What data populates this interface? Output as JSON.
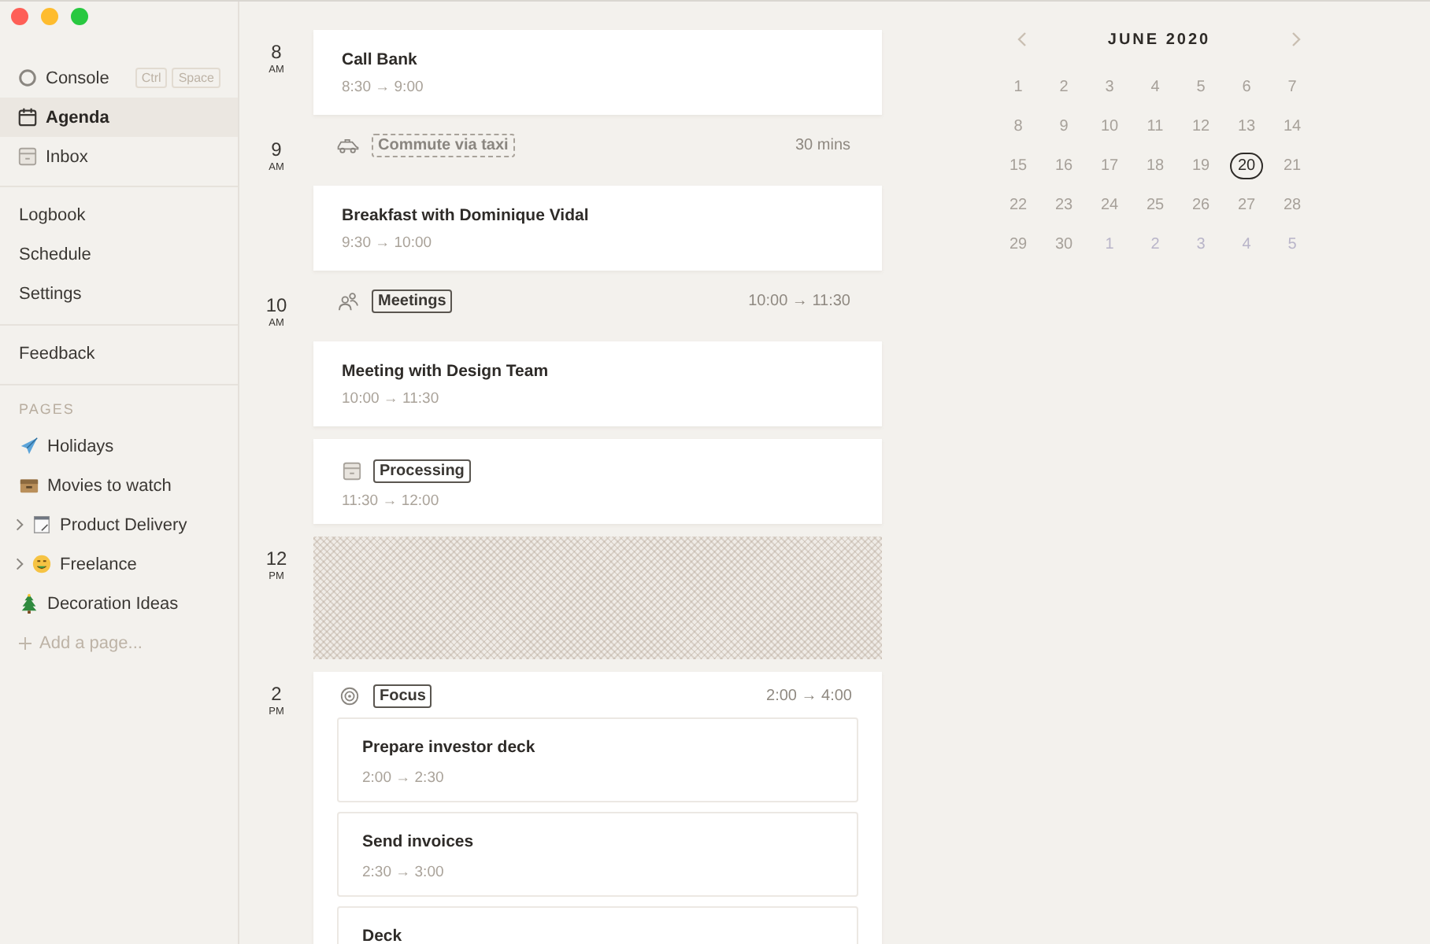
{
  "window_controls": [
    {
      "kind": "close"
    },
    {
      "kind": "minimize"
    },
    {
      "kind": "zoom"
    }
  ],
  "sidebar": {
    "nav": [
      {
        "label": "Console",
        "kind": "circle",
        "selected": false,
        "shortcut": [
          "Ctrl",
          "Space"
        ]
      },
      {
        "label": "Agenda",
        "kind": "calendar",
        "selected": true
      },
      {
        "label": "Inbox",
        "kind": "inbox",
        "selected": false
      }
    ],
    "sections": [
      [
        "Logbook",
        "Schedule",
        "Settings"
      ],
      [
        "Feedback"
      ]
    ],
    "pages_heading": "PAGES",
    "pages": [
      {
        "label": "Holidays",
        "kind": "plane"
      },
      {
        "label": "Movies to watch",
        "kind": "box"
      },
      {
        "label": "Product Delivery",
        "kind": "note",
        "expanded": false
      },
      {
        "label": "Freelance",
        "kind": "face",
        "expanded": false
      },
      {
        "label": "Decoration Ideas",
        "kind": "tree"
      }
    ],
    "add_page": "Add a page..."
  },
  "agenda": [
    {
      "hour": "8",
      "period": "AM",
      "kind": "event",
      "title": "Call Bank",
      "time": "8:30 → 9:00"
    },
    {
      "hour": "9",
      "period": "AM",
      "kind": "group",
      "tag": {
        "kind": "car",
        "label": "Commute via taxi",
        "dashed": true
      },
      "right": "30 mins"
    },
    {
      "kind": "event",
      "title": "Breakfast with Dominique Vidal",
      "time": "9:30 → 10:00"
    },
    {
      "hour": "10",
      "period": "AM",
      "kind": "group",
      "tag": {
        "kind": "people",
        "label": "Meetings",
        "dashed": false
      },
      "right": "10:00 → 11:30"
    },
    {
      "kind": "event",
      "title": "Meeting with Design Team",
      "time": "10:00 → 11:30"
    },
    {
      "kind": "tagged",
      "tag": {
        "kind": "inbox",
        "label": "Processing"
      },
      "time": "11:30 → 12:00"
    },
    {
      "hour": "12",
      "period": "PM",
      "kind": "blocked"
    },
    {
      "hour": "2",
      "period": "PM",
      "kind": "focus",
      "tag": {
        "kind": "target",
        "label": "Focus"
      },
      "right": "2:00 → 4:00",
      "tasks": [
        {
          "title": "Prepare investor deck",
          "time": "2:00 → 2:30"
        },
        {
          "title": "Send invoices",
          "time": "2:30 → 3:00"
        },
        {
          "title": "Deck"
        }
      ]
    }
  ],
  "calendar": {
    "title": "JUNE 2020",
    "weeks": [
      [
        {
          "d": "1",
          "outside": false,
          "selected": false
        },
        {
          "d": "2",
          "outside": false,
          "selected": false
        },
        {
          "d": "3",
          "outside": false,
          "selected": false
        },
        {
          "d": "4",
          "outside": false,
          "selected": false
        },
        {
          "d": "5",
          "outside": false,
          "selected": false
        },
        {
          "d": "6",
          "outside": false,
          "selected": false
        },
        {
          "d": "7",
          "outside": false,
          "selected": false
        }
      ],
      [
        {
          "d": "8",
          "outside": false,
          "selected": false
        },
        {
          "d": "9",
          "outside": false,
          "selected": false
        },
        {
          "d": "10",
          "outside": false,
          "selected": false
        },
        {
          "d": "11",
          "outside": false,
          "selected": false
        },
        {
          "d": "12",
          "outside": false,
          "selected": false
        },
        {
          "d": "13",
          "outside": false,
          "selected": false
        },
        {
          "d": "14",
          "outside": false,
          "selected": false
        }
      ],
      [
        {
          "d": "15",
          "outside": false,
          "selected": false
        },
        {
          "d": "16",
          "outside": false,
          "selected": false
        },
        {
          "d": "17",
          "outside": false,
          "selected": false
        },
        {
          "d": "18",
          "outside": false,
          "selected": false
        },
        {
          "d": "19",
          "outside": false,
          "selected": false
        },
        {
          "d": "20",
          "outside": false,
          "selected": true
        },
        {
          "d": "21",
          "outside": false,
          "selected": false
        }
      ],
      [
        {
          "d": "22",
          "outside": false,
          "selected": false
        },
        {
          "d": "23",
          "outside": false,
          "selected": false
        },
        {
          "d": "24",
          "outside": false,
          "selected": false
        },
        {
          "d": "25",
          "outside": false,
          "selected": false
        },
        {
          "d": "26",
          "outside": false,
          "selected": false
        },
        {
          "d": "27",
          "outside": false,
          "selected": false
        },
        {
          "d": "28",
          "outside": false,
          "selected": false
        }
      ],
      [
        {
          "d": "29",
          "outside": false,
          "selected": false
        },
        {
          "d": "30",
          "outside": false,
          "selected": false
        },
        {
          "d": "1",
          "outside": true,
          "selected": false
        },
        {
          "d": "2",
          "outside": true,
          "selected": false
        },
        {
          "d": "3",
          "outside": true,
          "selected": false
        },
        {
          "d": "4",
          "outside": true,
          "selected": false
        },
        {
          "d": "5",
          "outside": true,
          "selected": false
        }
      ]
    ]
  }
}
